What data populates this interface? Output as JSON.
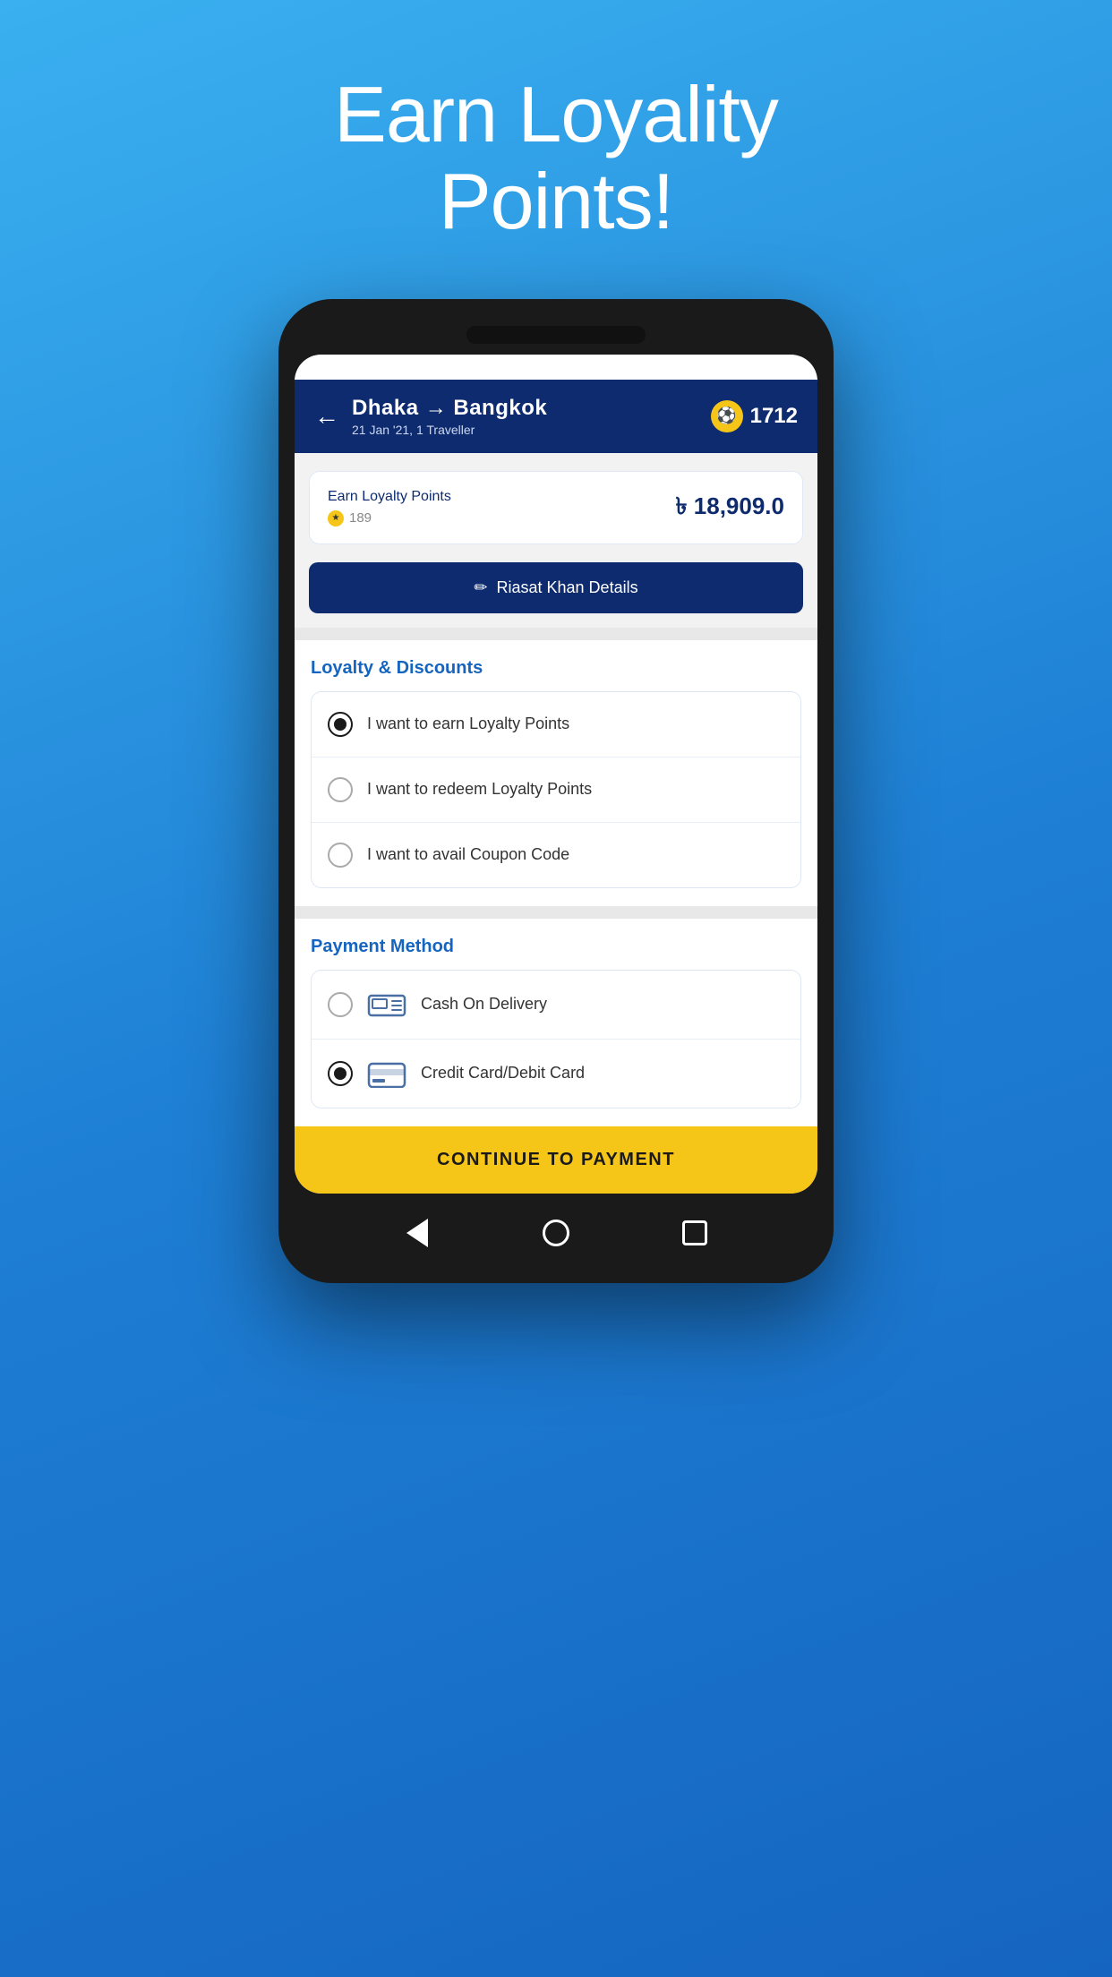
{
  "page": {
    "title_line1": "Earn Loyality",
    "title_line2": "Points!"
  },
  "header": {
    "back_label": "←",
    "route": "Dhaka → Bangkok",
    "sub": "21 Jan '21, 1 Traveller",
    "points": "1712"
  },
  "loyalty_card": {
    "label": "Earn Loyalty Points",
    "points_count": "189",
    "price": "৳ 18,909.0"
  },
  "details_button": {
    "label": "Riasat Khan Details",
    "pencil": "✏"
  },
  "loyalty_section": {
    "title": "Loyalty & Discounts",
    "options": [
      {
        "id": "earn",
        "label": "I want to earn Loyalty Points",
        "selected": true
      },
      {
        "id": "redeem",
        "label": "I want to redeem Loyalty Points",
        "selected": false
      },
      {
        "id": "coupon",
        "label": "I want to avail Coupon Code",
        "selected": false
      }
    ]
  },
  "payment_section": {
    "title": "Payment Method",
    "options": [
      {
        "id": "cod",
        "label": "Cash On Delivery",
        "selected": false,
        "icon": "cash"
      },
      {
        "id": "card",
        "label": "Credit Card/Debit Card",
        "selected": true,
        "icon": "card"
      }
    ]
  },
  "continue_button": {
    "label": "CONTINUE TO PAYMENT"
  },
  "bottom_nav": {
    "back": "back",
    "home": "home",
    "recent": "recent"
  }
}
